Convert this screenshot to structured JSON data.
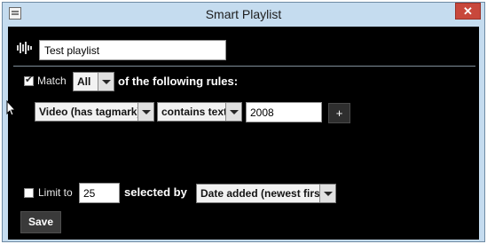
{
  "window": {
    "title": "Smart Playlist"
  },
  "playlist": {
    "name": "Test playlist"
  },
  "match": {
    "checked": true,
    "label": "Match",
    "mode": "All",
    "suffix": "of the following rules:"
  },
  "rule": {
    "field": "Video (has tagmark)",
    "operator": "contains text",
    "value": "2008",
    "add_label": "+"
  },
  "limit": {
    "checked": false,
    "label": "Limit to",
    "count": "25",
    "selected_by_label": "selected by",
    "order": "Date added (newest first)"
  },
  "save_label": "Save"
}
